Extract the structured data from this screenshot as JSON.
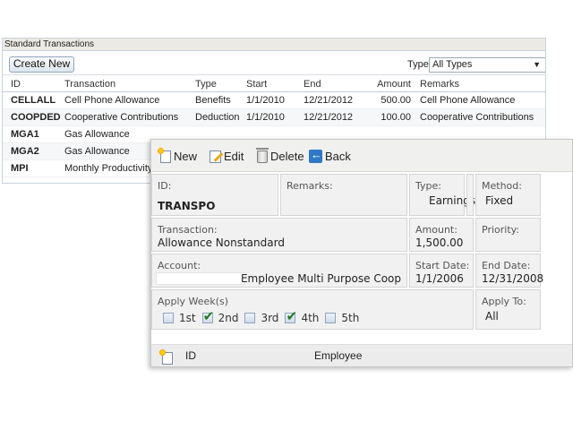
{
  "list": {
    "title": "Standard Transactions",
    "create_new_label": "Create New",
    "type_filter_label": "Type:",
    "type_filter_value": "All Types",
    "columns": [
      "ID",
      "Transaction",
      "Type",
      "Start",
      "End",
      "Amount",
      "Remarks"
    ],
    "rows": [
      {
        "id": "CELLALL",
        "transaction": "Cell Phone Allowance",
        "type": "Benefits",
        "start": "1/1/2010",
        "end": "12/21/2012",
        "amount": "500.00",
        "remarks": "Cell Phone Allowance"
      },
      {
        "id": "COOPDED",
        "transaction": "Cooperative Contributions",
        "type": "Deduction",
        "start": "1/1/2010",
        "end": "12/21/2012",
        "amount": "100.00",
        "remarks": "Cooperative Contributions"
      },
      {
        "id": "MGA1",
        "transaction": "Gas Allowance",
        "type": "",
        "start": "",
        "end": "",
        "amount": "",
        "remarks": ""
      },
      {
        "id": "MGA2",
        "transaction": "Gas Allowance",
        "type": "",
        "start": "",
        "end": "",
        "amount": "",
        "remarks": ""
      },
      {
        "id": "MPI",
        "transaction": "Monthly Productivity i",
        "type": "",
        "start": "",
        "end": "",
        "amount": "",
        "remarks": ""
      }
    ]
  },
  "detail": {
    "toolbar": {
      "new_label": "New",
      "edit_label": "Edit",
      "delete_label": "Delete",
      "back_label": "Back"
    },
    "fields": {
      "id_label": "ID:",
      "id_value": "TRANSPO",
      "remarks_label": "Remarks:",
      "type_label": "Type:",
      "type_value": "Earnings",
      "method_label": "Method:",
      "method_value": "Fixed",
      "transaction_label": "Transaction:",
      "transaction_value": "Allowance Nonstandard",
      "amount_label": "Amount:",
      "amount_value": "1,500.00",
      "priority_label": "Priority:",
      "account_label": "Account:",
      "account_value": "Employee Multi Purpose Coop",
      "start_date_label": "Start Date:",
      "start_date_value": "1/1/2006",
      "end_date_label": "End Date:",
      "end_date_value": "12/31/2008",
      "apply_week_label": "Apply Week(s)",
      "apply_to_label": "Apply To:",
      "apply_to_value": "All"
    },
    "weeks": [
      {
        "label": "1st",
        "checked": false
      },
      {
        "label": "2nd",
        "checked": true
      },
      {
        "label": "3rd",
        "checked": false
      },
      {
        "label": "4th",
        "checked": true
      },
      {
        "label": "5th",
        "checked": false
      }
    ],
    "sub_grid": {
      "id_label": "ID",
      "employee_label": "Employee"
    }
  }
}
